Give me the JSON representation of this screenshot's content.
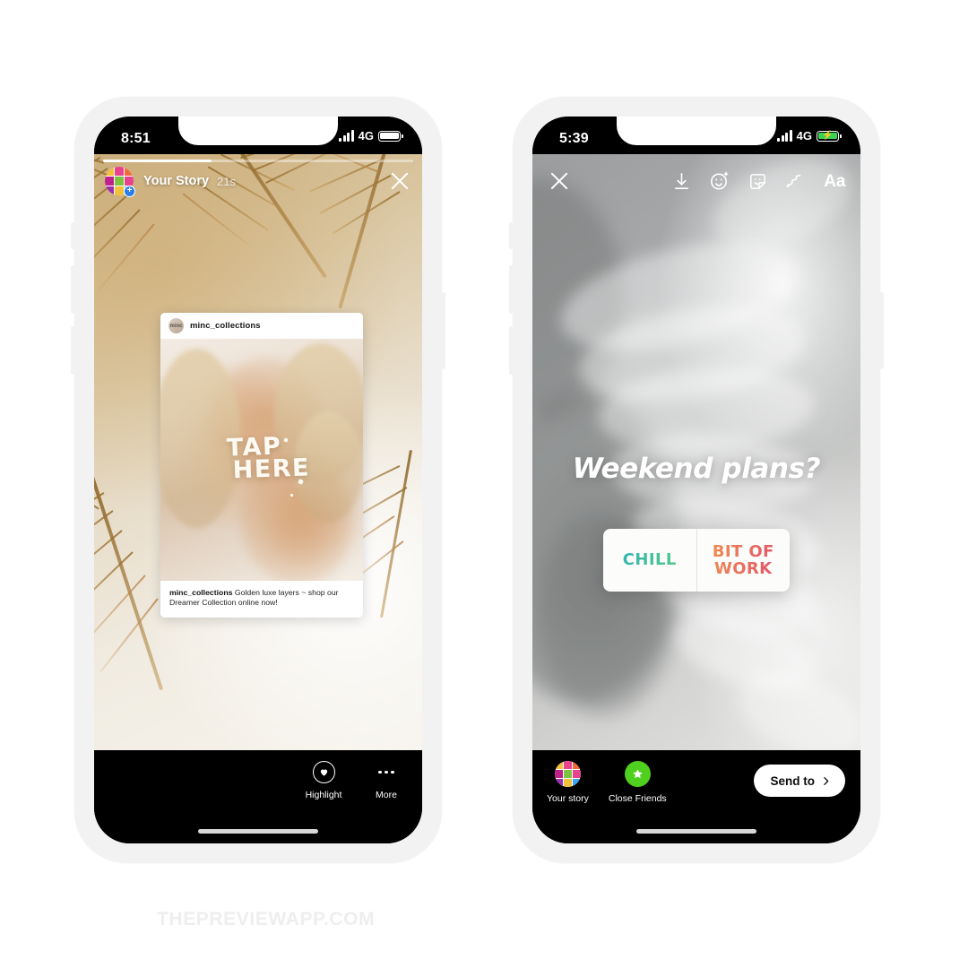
{
  "watermark": "THEPREVIEWAPP.COM",
  "phone_left": {
    "status": {
      "time": "8:51",
      "network": "4G",
      "battery_charging": false,
      "signal_icon": "signal-bars-icon",
      "battery_icon": "battery-icon"
    },
    "story": {
      "avatar_icon": "preview-grid-avatar",
      "add_badge": "+",
      "username": "Your Story",
      "elapsed": "21s",
      "close_icon": "close-icon",
      "progress_percent": 35
    },
    "post_card": {
      "avatar_icon": "minc-avatar",
      "avatar_text": "minc",
      "handle": "minc_collections",
      "overlay_line1": "TAP",
      "overlay_line2": "HERE",
      "caption_author": "minc_collections",
      "caption_text": " Golden luxe layers ~ shop our Dreamer Collection online now!"
    },
    "bottom_actions": [
      {
        "label": "Highlight",
        "icon": "heart-circle-icon"
      },
      {
        "label": "More",
        "icon": "more-dots-icon"
      }
    ]
  },
  "phone_right": {
    "status": {
      "time": "5:39",
      "network": "4G",
      "battery_charging": true,
      "signal_icon": "signal-bars-icon",
      "battery_icon": "battery-charging-icon"
    },
    "toolbar": {
      "close_icon": "close-icon",
      "tools": [
        {
          "name": "download-icon",
          "label": "Download"
        },
        {
          "name": "effects-icon",
          "label": "Effects"
        },
        {
          "name": "sticker-icon",
          "label": "Stickers"
        },
        {
          "name": "draw-icon",
          "label": "Draw"
        },
        {
          "name": "text-icon",
          "label": "Aa"
        }
      ],
      "text_tool_label": "Aa"
    },
    "creative": {
      "title": "Weekend plans?",
      "poll": {
        "option_left": "CHILL",
        "option_right_line1": "BIT OF",
        "option_right_line2": "WORK",
        "color_left_start": "#35b6b0",
        "color_left_end": "#4ec88a",
        "color_right_start": "#f08a52",
        "color_right_end": "#e3556a"
      }
    },
    "share": {
      "targets": [
        {
          "label": "Your story",
          "icon": "preview-grid-avatar"
        },
        {
          "label": "Close Friends",
          "icon": "close-friends-star-icon"
        }
      ],
      "send_button_label": "Send to",
      "send_button_icon": "chevron-right-icon"
    }
  },
  "avatar_colors": [
    "#f3c13a",
    "#e8428f",
    "#f06a3a",
    "#c0208a",
    "#7fc242",
    "#e8428f",
    "#9b2fae",
    "#f3c13a",
    "#3ba5f0"
  ]
}
